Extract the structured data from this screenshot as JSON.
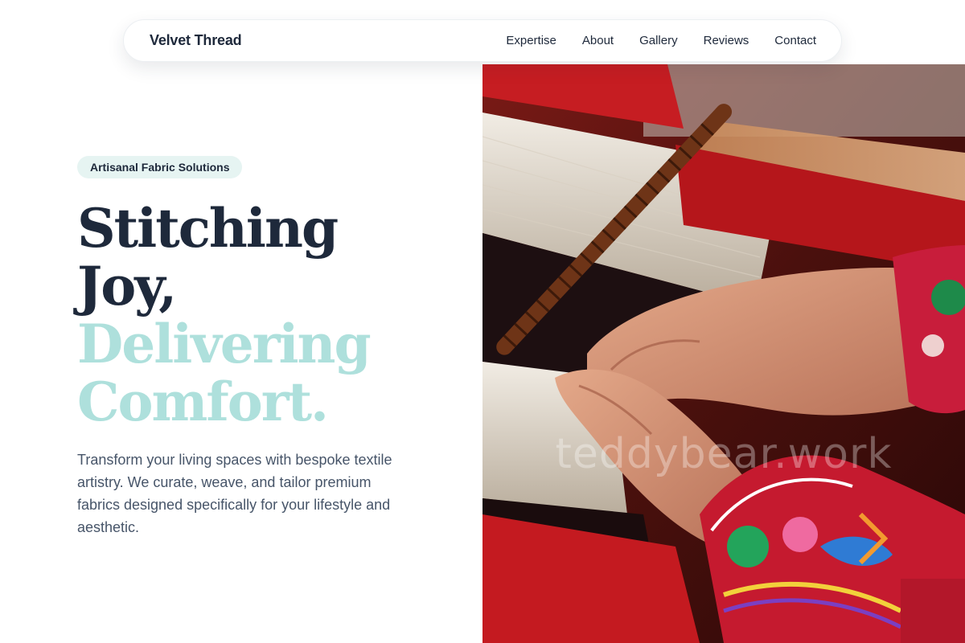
{
  "nav": {
    "brand": "Velvet Thread",
    "links": [
      {
        "label": "Expertise"
      },
      {
        "label": "About"
      },
      {
        "label": "Gallery"
      },
      {
        "label": "Reviews"
      },
      {
        "label": "Contact"
      }
    ]
  },
  "hero": {
    "badge": "Artisanal Fabric Solutions",
    "headline_dark": [
      "Stitching",
      "Joy,"
    ],
    "headline_light": [
      "Delivering",
      "Comfort."
    ],
    "description": "Transform your living spaces with bespoke textile artistry. We curate, weave, and tailor premium fabrics designed specifically for your lifestyle and aesthetic.",
    "image": {
      "watermark": "teddybear.work"
    }
  },
  "colors": {
    "text_dark": "#1e293b",
    "accent_light": "#aee0dc",
    "badge_bg": "#e6f4f2",
    "body_text": "#475569"
  }
}
